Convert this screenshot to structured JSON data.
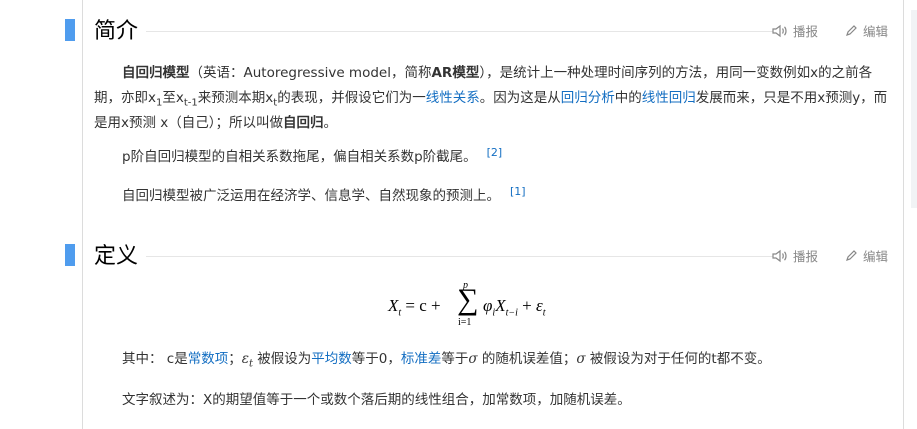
{
  "sections": [
    {
      "title": "简介",
      "report_label": "播报",
      "edit_label": "编辑"
    },
    {
      "title": "定义",
      "report_label": "播报",
      "edit_label": "编辑"
    }
  ],
  "intro": {
    "p1": {
      "term": "自回归模型",
      "t1": "（英语：Autoregressive model，简称",
      "abbr": "AR模型",
      "t2": "），是统计上一种处理时间序列的方法，用同一变数例如x的之前各期，亦即x",
      "s1": "1",
      "t3": "至x",
      "s2": "t-1",
      "t4": "来预测本期x",
      "s3": "t",
      "t5": "的表现，并假设它们为一",
      "link1": "线性关系",
      "t6": "。因为这是从",
      "link2": "回归分析",
      "t7": "中的",
      "link3": "线性回归",
      "t8": "发展而来，只是不用x预测y，而是用x预测 x（自己）；所以叫做",
      "term2": "自回归",
      "t9": "。"
    },
    "p2": {
      "text": "p阶自回归模型的自相关系数拖尾，偏自相关系数p阶截尾。",
      "ref": "[2]"
    },
    "p3": {
      "text": "自回归模型被广泛运用在经济学、信息学、自然现象的预测上。",
      "ref": "[1]"
    }
  },
  "definition": {
    "formula": {
      "lhs": "X",
      "lhs_sub": "t",
      "eq": " = c + ",
      "sum_upper": "p",
      "sum_lower": "i=1",
      "rhs_phi": "φ",
      "rhs_phi_sub": "i",
      "rhs_x": "X",
      "rhs_x_sub": "t−i",
      "rhs_plus": " + ",
      "rhs_eps": "ε",
      "rhs_eps_sub": "t"
    },
    "p1": {
      "t1": "其中：  c是",
      "link1": "常数项",
      "t2": "；",
      "eps": "ε",
      "eps_sub": "t",
      "t3": " 被假设为",
      "link2": "平均数",
      "t4": "等于0，",
      "link3": "标准差",
      "t5": "等于",
      "sigma1": "σ",
      "t6": " 的随机误差值；",
      "sigma2": "σ",
      "t7": " 被假设为对于任何的t都不变。"
    },
    "p2": {
      "text": "文字叙述为：X的期望值等于一个或数个落后期的线性组合，加常数项，加随机误差。"
    }
  }
}
